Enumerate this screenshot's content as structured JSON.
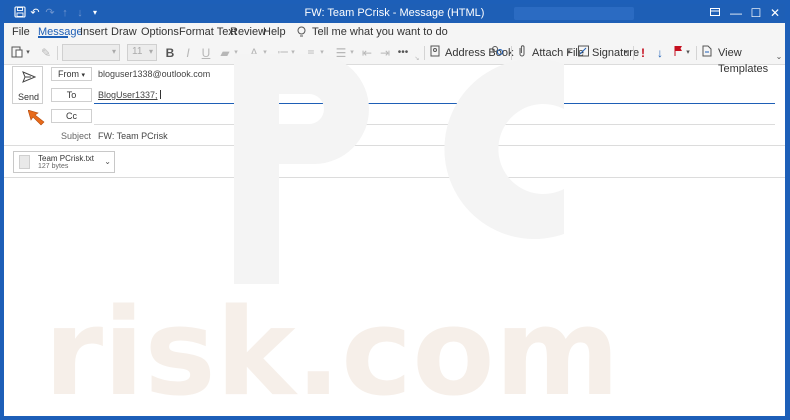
{
  "window": {
    "title": "FW: Team PCrisk  -  Message (HTML)",
    "controls": {
      "restore_ribbon_icon": "ribbon-display-icon",
      "minimize": "—",
      "maximize": "☐",
      "close": "✕"
    }
  },
  "quick_access": [
    "save-icon",
    "undo-icon",
    "redo-icon",
    "up-icon",
    "down-icon",
    "customize-icon"
  ],
  "menu": {
    "tabs": [
      "File",
      "Message",
      "Insert",
      "Draw",
      "Options",
      "Format Text",
      "Review",
      "Help"
    ],
    "active": "Message",
    "tell_me": "Tell me what you want to do"
  },
  "ribbon": {
    "font_size": "11",
    "address_book": "Address Book",
    "attach_file": "Attach File",
    "signature": "Signature",
    "view_templates": "View Templates",
    "more": "•••"
  },
  "compose": {
    "send_label": "Send",
    "from_label": "From",
    "from_value": "bloguser1338@outlook.com",
    "to_label": "To",
    "to_value": "BlogUser1337;",
    "cc_label": "Cc",
    "cc_value": "",
    "subject_label": "Subject",
    "subject_value": "FW: Team PCrisk"
  },
  "attachment": {
    "name": "Team PCrisk.txt",
    "size": "127 bytes"
  },
  "colors": {
    "accent": "#1e5fb6",
    "flag": "#c50f1f",
    "pointer": "#e86a1a"
  }
}
